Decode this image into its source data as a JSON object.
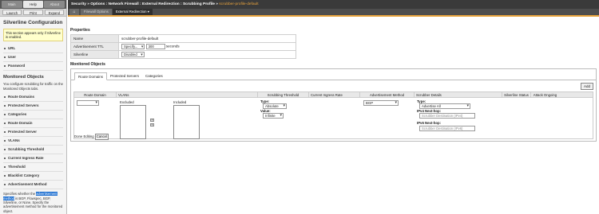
{
  "help_pane": {
    "tabs": [
      "Main",
      "Help",
      "About"
    ],
    "active_tab": 1,
    "tools": [
      "Launch",
      "Print",
      "Expand"
    ],
    "title": "Silverline Configuration",
    "note": "This section appears only if Silverline is enabled.",
    "config_items": [
      "URL",
      "User",
      "Password"
    ],
    "monitored_heading": "Monitored Objects",
    "monitored_text": "You configure scrubbing for traffic on the Monitored Objects tabs.",
    "monitored_items": [
      "Route Domains",
      "Protected Servers",
      "Categories",
      "Route Domain",
      "Protected Server",
      "VLANs",
      "Scrubbing Threshold",
      "Current Ingress Rate",
      "Threshold",
      "Blacklist Category",
      "Advertisement Method"
    ],
    "footer_pre": "Specifies whether the",
    "footer_highlight": "advertisement method",
    "footer_post": "is BGP, Flowspec, BGP, Silverline, or None. Specify the advertisement method for the monitored object."
  },
  "header": {
    "crumb_path": "Security  »  Options : Network Firewall : External Redirection : Scrubbing Profile  »",
    "crumb_current": "scrubber-profile-default"
  },
  "tabs": {
    "home_icon": "⌂",
    "items": [
      "Firewall Options",
      "External Redirection ▾"
    ],
    "active": 1
  },
  "properties": {
    "heading": "Properties",
    "name_label": "Name",
    "name_value": "scrubber-profile-default",
    "ttl_label": "Advertisement TTL",
    "ttl_mode": "Specify...",
    "ttl_value": "300",
    "ttl_unit": "seconds",
    "silverline_label": "Silverline",
    "silverline_value": "Disabled"
  },
  "monitored": {
    "heading": "Monitored Objects",
    "tabs": [
      "Route Domains",
      "Protected Servers",
      "Categories"
    ],
    "active_tab": 0,
    "add_button": "Add",
    "columns": [
      "Route Domain",
      "VLANs",
      "Scrubbing Threshold",
      "Current Ingress Rate",
      "Advertisement Method",
      "Scrubber Details",
      "Silverline Status",
      "Attack Ongoing"
    ],
    "route_domain_value": "",
    "vlans_excluded_label": "Excluded",
    "vlans_included_label": "Included",
    "move_right": "»",
    "move_left": "«",
    "done_button": "Done Editing",
    "cancel_button": "Cancel",
    "threshold_type_label": "Type:",
    "threshold_type_value": "Absolute",
    "threshold_value_label": "Value:",
    "threshold_value": "Infinite",
    "adv_method_value": "BGP",
    "scrubber_type_label": "Type:",
    "scrubber_type_value": "Advertise All",
    "ipv4_label": "IPv4 Next-hop:",
    "ipv4_placeholder": "Scrubber Destination (IPv4)",
    "ipv6_label": "IPv6 Next-hop:",
    "ipv6_placeholder": "Scrubber Destination (IPv6)"
  },
  "colors": {
    "accent": "#e8a33d",
    "header_bg": "#3a3a3a",
    "highlight": "#1d6fd1"
  }
}
